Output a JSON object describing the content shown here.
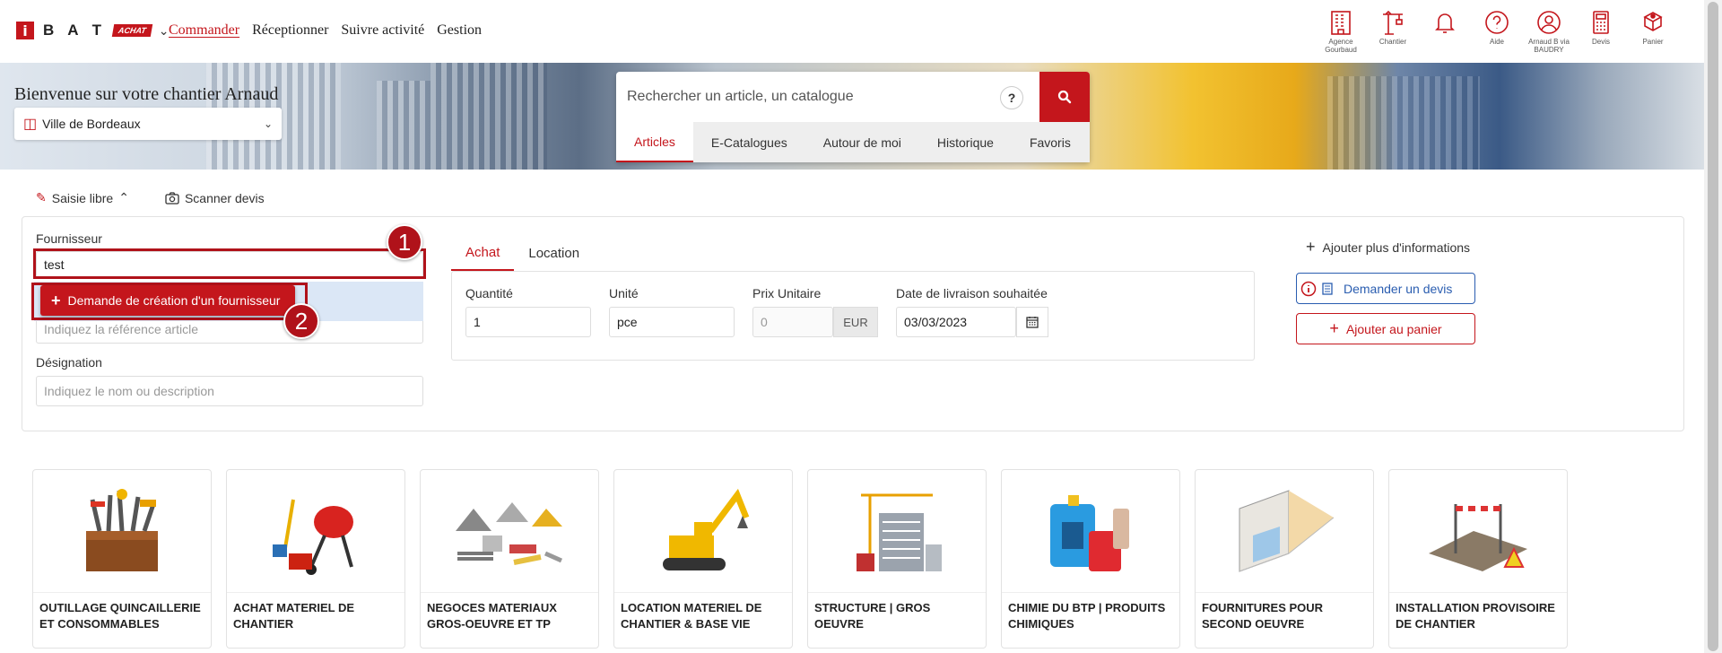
{
  "header": {
    "logo_i": "i",
    "logo_letters": [
      "B",
      "A",
      "T"
    ],
    "logo_badge": "ACHAT",
    "nav": [
      "Commander",
      "Réceptionner",
      "Suivre activité",
      "Gestion"
    ],
    "icons": [
      {
        "name": "agence-icon",
        "label": "Agence Gourbaud"
      },
      {
        "name": "chantier-icon",
        "label": "Chantier"
      },
      {
        "name": "bell-icon",
        "label": ""
      },
      {
        "name": "help-icon",
        "label": "Aide"
      },
      {
        "name": "user-icon",
        "label": "Arnaud B via BAUDRY"
      },
      {
        "name": "calculator-icon",
        "label": "Devis"
      },
      {
        "name": "cart-icon",
        "label": "Panier"
      }
    ]
  },
  "hero": {
    "welcome": "Bienvenue sur votre chantier Arnaud",
    "site": "Ville de Bordeaux",
    "search_placeholder": "Rechercher un article, un catalogue",
    "help": "?",
    "tabs": [
      "Articles",
      "E-Catalogues",
      "Autour de moi",
      "Historique",
      "Favoris"
    ]
  },
  "modes": {
    "saisie": "Saisie libre",
    "scanner": "Scanner devis"
  },
  "form": {
    "fournisseur_label": "Fournisseur",
    "fournisseur_value": "test",
    "create_supplier": "Demande de création d'un fournisseur",
    "reference_placeholder": "Indiquez la référence article",
    "designation_label": "Désignation",
    "designation_placeholder": "Indiquez le nom ou description",
    "step1": "1",
    "step2": "2",
    "purchase_tabs": [
      "Achat",
      "Location"
    ],
    "quantite_label": "Quantité",
    "quantite_value": "1",
    "unite_label": "Unité",
    "unite_value": "pce",
    "prix_label": "Prix Unitaire",
    "prix_placeholder": "0",
    "prix_currency": "EUR",
    "date_label": "Date de livraison souhaitée",
    "date_value": "03/03/2023",
    "more_info": "Ajouter plus d'informations",
    "devis_button": "Demander un devis",
    "cart_button": "Ajouter au panier"
  },
  "categories": [
    {
      "name": "OUTILLAGE QUINCAILLERIE ET CONSOMMABLES",
      "icon": "toolbox-icon"
    },
    {
      "name": "ACHAT MATERIEL DE CHANTIER",
      "icon": "cement-mixer-icon"
    },
    {
      "name": "NEGOCES MATERIAUX GROS-OEUVRE ET TP",
      "icon": "materials-icon"
    },
    {
      "name": "LOCATION MATERIEL DE CHANTIER & BASE VIE",
      "icon": "excavator-icon"
    },
    {
      "name": "STRUCTURE | GROS OEUVRE",
      "icon": "building-crane-icon"
    },
    {
      "name": "CHIMIE DU BTP | PRODUITS CHIMIQUES",
      "icon": "chemical-cans-icon"
    },
    {
      "name": "FOURNITURES POUR SECOND OEUVRE",
      "icon": "room-interior-icon"
    },
    {
      "name": "INSTALLATION PROVISOIRE DE CHANTIER",
      "icon": "site-barrier-icon"
    }
  ],
  "colors": {
    "brand": "#c4161c",
    "link_blue": "#2a5db0"
  }
}
